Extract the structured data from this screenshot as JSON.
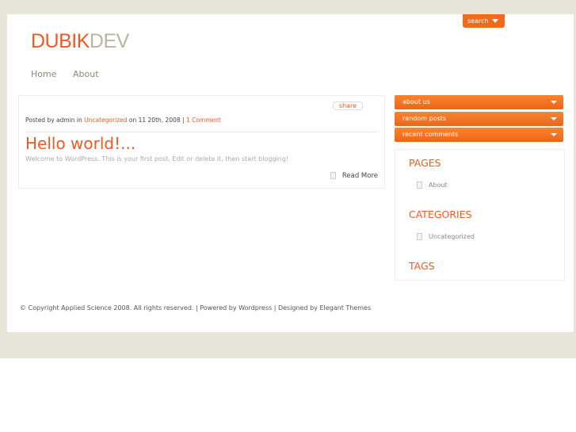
{
  "header": {
    "logo_part1": "DUBIK",
    "logo_part2": "DEV",
    "search_label": "search"
  },
  "nav": [
    "Home",
    "About"
  ],
  "post": {
    "share": "share",
    "meta_prefix": "Posted by admin in ",
    "category": "Uncategorized",
    "meta_date": " on 11 20th, 2008 | ",
    "comments": "1 Comment",
    "title": "Hello world!...",
    "excerpt": "Welcome to WordPress. This is your first post. Edit or delete it, then start blogging!",
    "read_more": "Read More"
  },
  "sidebar": {
    "tabs": [
      "about us",
      "random posts",
      "recent comments"
    ],
    "pages_title": "PAGES",
    "pages": [
      "About"
    ],
    "categories_title": "CATEGORIES",
    "categories": [
      "Uncategorized"
    ],
    "tags_title": "TAGS"
  },
  "footer": "© Copyright Applied Science 2008. All rights reserved. | Powered by Wordpress | Designed by Elegant Themes"
}
